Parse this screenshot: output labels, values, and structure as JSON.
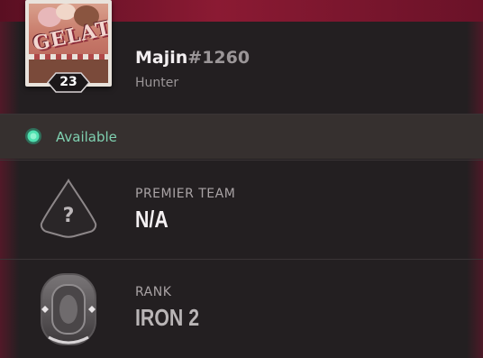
{
  "player": {
    "name": "Majin",
    "tag": "#1260",
    "title": "Hunter",
    "level": "23",
    "card_text": "GELATO"
  },
  "status": {
    "label": "Available",
    "color": "#3fbf8f"
  },
  "premier": {
    "label": "PREMIER TEAM",
    "value": "N/A",
    "icon": "question-mark-cone-icon"
  },
  "rank": {
    "label": "RANK",
    "value": "IRON 2",
    "icon": "iron-rank-icon"
  },
  "colors": {
    "background": "#231f21",
    "accent": "#8b1a33",
    "status_available": "#7fd0b0"
  }
}
